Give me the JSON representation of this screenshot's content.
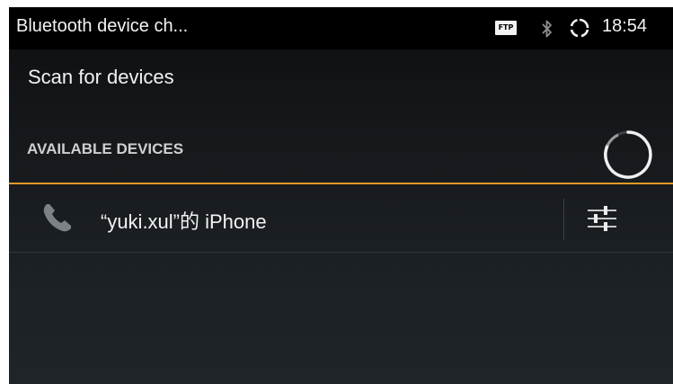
{
  "status_bar": {
    "title": "Bluetooth device ch...",
    "ftp_badge": "FTP",
    "bluetooth_icon": "bluetooth-icon",
    "sync_icon": "sync-icon",
    "time": "18:54"
  },
  "scan": {
    "label": "Scan for devices"
  },
  "available_devices": {
    "header": "AVAILABLE DEVICES",
    "progress_icon": "progress-spinner-icon",
    "devices": [
      {
        "name": "“yuki.xul”的 iPhone",
        "icon": "phone-icon",
        "settings_icon": "settings-sliders-icon"
      }
    ]
  },
  "colors": {
    "accent": "#e39a27",
    "background": "#1c2125",
    "text": "#f2f2f2"
  }
}
